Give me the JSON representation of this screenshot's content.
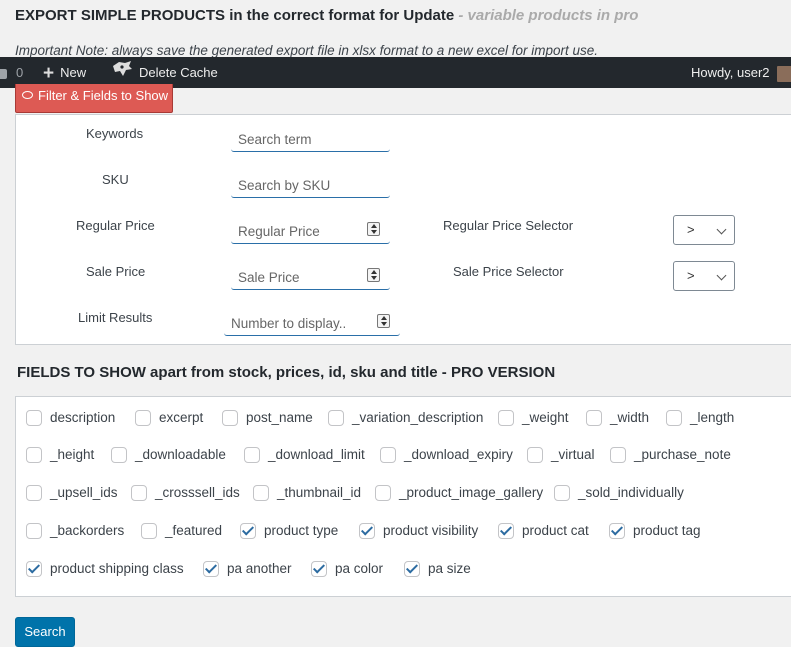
{
  "header": {
    "title_main": "EXPORT SIMPLE PRODUCTS in the correct format for Update",
    "title_pro": " - variable products in pro",
    "note": "Important Note: always save the generated export file in xlsx format to a new excel for import use."
  },
  "adminbar": {
    "comments_count": "0",
    "new_label": "New",
    "delete_cache_label": "Delete Cache",
    "howdy": "Howdy, user2"
  },
  "filter": {
    "button_label": "Filter & Fields to Show",
    "keywords_label": "Keywords",
    "keywords_placeholder": "Search term",
    "sku_label": "SKU",
    "sku_placeholder": "Search by SKU",
    "regular_price_label": "Regular Price",
    "regular_price_placeholder": "Regular Price",
    "regular_selector_label": "Regular Price Selector",
    "regular_selector_value": ">",
    "sale_price_label": "Sale Price",
    "sale_price_placeholder": "Sale Price",
    "sale_selector_label": "Sale Price Selector",
    "sale_selector_value": ">",
    "limit_label": "Limit Results",
    "limit_placeholder": "Number to display.."
  },
  "fields": {
    "title": "FIELDS TO SHOW apart from stock, prices, id, sku and title - PRO VERSION",
    "items": [
      {
        "label": "description",
        "checked": false
      },
      {
        "label": "excerpt",
        "checked": false
      },
      {
        "label": "post_name",
        "checked": false
      },
      {
        "label": "_variation_description",
        "checked": false
      },
      {
        "label": "_weight",
        "checked": false
      },
      {
        "label": "_width",
        "checked": false
      },
      {
        "label": "_length",
        "checked": false
      },
      {
        "label": "_height",
        "checked": false
      },
      {
        "label": "_downloadable",
        "checked": false
      },
      {
        "label": "_download_limit",
        "checked": false
      },
      {
        "label": "_download_expiry",
        "checked": false
      },
      {
        "label": "_virtual",
        "checked": false
      },
      {
        "label": "_purchase_note",
        "checked": false
      },
      {
        "label": "_upsell_ids",
        "checked": false
      },
      {
        "label": "_crosssell_ids",
        "checked": false
      },
      {
        "label": "_thumbnail_id",
        "checked": false
      },
      {
        "label": "_product_image_gallery",
        "checked": false
      },
      {
        "label": "_sold_individually",
        "checked": false
      },
      {
        "label": "_backorders",
        "checked": false
      },
      {
        "label": "_featured",
        "checked": false
      },
      {
        "label": "product type",
        "checked": true
      },
      {
        "label": "product visibility",
        "checked": true
      },
      {
        "label": "product cat",
        "checked": true
      },
      {
        "label": "product tag",
        "checked": true
      },
      {
        "label": "product shipping class",
        "checked": true
      },
      {
        "label": "pa another",
        "checked": true
      },
      {
        "label": "pa color",
        "checked": true
      },
      {
        "label": "pa size",
        "checked": true
      }
    ]
  },
  "search_button_label": "Search"
}
